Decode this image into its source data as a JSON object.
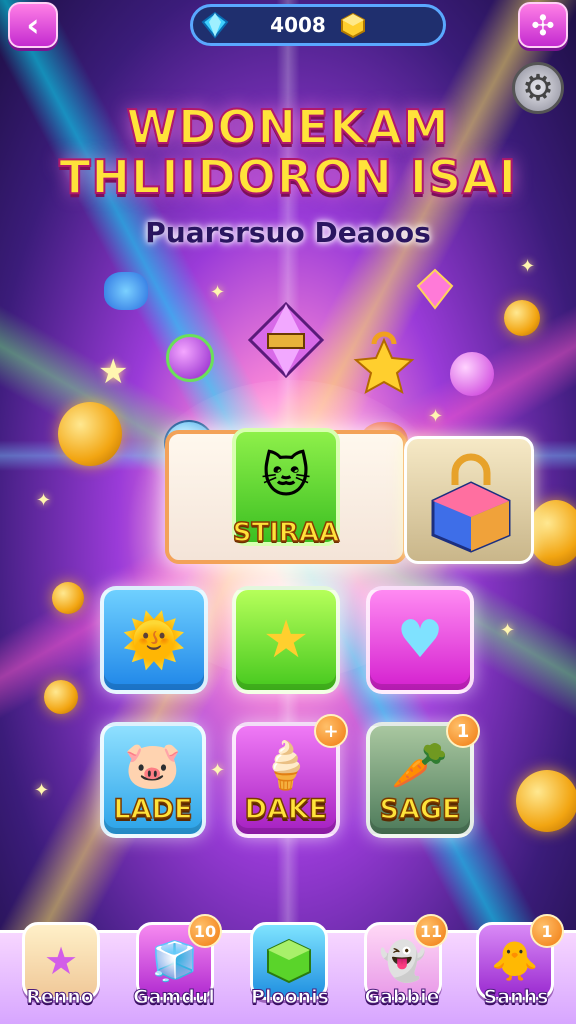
{
  "header": {
    "back_icon": "back-arrow-icon",
    "currency_amount": "4008",
    "currency_icons": [
      "blue-gem-icon",
      "gold-cube-icon"
    ],
    "menu_icon": "puzzle-icon",
    "settings_icon": "gear-icon"
  },
  "title": {
    "line1": "WDONEKAM",
    "line2": "THLIIDORON ISAI",
    "subtitle": "Puarsrsuo Deaoos"
  },
  "featured": {
    "label": "STIRAA",
    "icon": "green-cat-icon",
    "side_icon": "padlock-cube-icon"
  },
  "grid": {
    "row1": [
      {
        "icon": "sun-creature-icon",
        "color": "#2ea8ff"
      },
      {
        "icon": "star-icon",
        "color": "#6fe03a"
      },
      {
        "icon": "heart-icon",
        "color": "#ee3ce0"
      }
    ],
    "row2": [
      {
        "label": "LADE",
        "icon": "pink-pig-icon",
        "badge": ""
      },
      {
        "label": "DAKE",
        "icon": "ice-cream-icon",
        "badge": "+"
      },
      {
        "label": "SAGE",
        "icon": "carrot-icon",
        "badge": "1"
      }
    ]
  },
  "bottom_nav": [
    {
      "label": "Renno",
      "icon": "star-icon",
      "badge": ""
    },
    {
      "label": "Gamdul",
      "icon": "box-icon",
      "badge": "10"
    },
    {
      "label": "Ploonis",
      "icon": "green-cube-icon",
      "badge": ""
    },
    {
      "label": "Gabbie",
      "icon": "ghost-icon",
      "badge": "11"
    },
    {
      "label": "Sanhs",
      "icon": "chick-icon",
      "badge": "1"
    }
  ]
}
